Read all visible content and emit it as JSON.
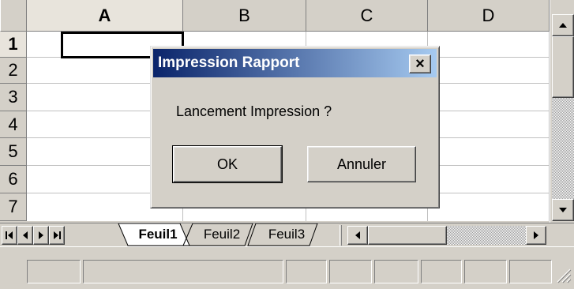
{
  "columns": [
    "A",
    "B",
    "C",
    "D"
  ],
  "rows": [
    "1",
    "2",
    "3",
    "4",
    "5",
    "6",
    "7"
  ],
  "sheet_tabs": [
    "Feuil1",
    "Feuil2",
    "Feuil3"
  ],
  "dialog": {
    "title": "Impression Rapport",
    "close_label": "×",
    "message": "Lancement Impression ?",
    "ok_label": "OK",
    "cancel_label": "Annuler"
  },
  "icons": {
    "scroll_up": "triangle-up-icon",
    "scroll_down": "triangle-down-icon",
    "scroll_left": "triangle-left-icon",
    "scroll_right": "triangle-right-icon",
    "tab_first": "first-sheet-icon",
    "tab_prev": "prev-sheet-icon",
    "tab_next": "next-sheet-icon",
    "tab_last": "last-sheet-icon",
    "resize_grip": "resize-grip-icon"
  },
  "colors": {
    "titlebar_start": "#0a246a",
    "titlebar_end": "#a6caf0",
    "face": "#d4d0c8"
  }
}
